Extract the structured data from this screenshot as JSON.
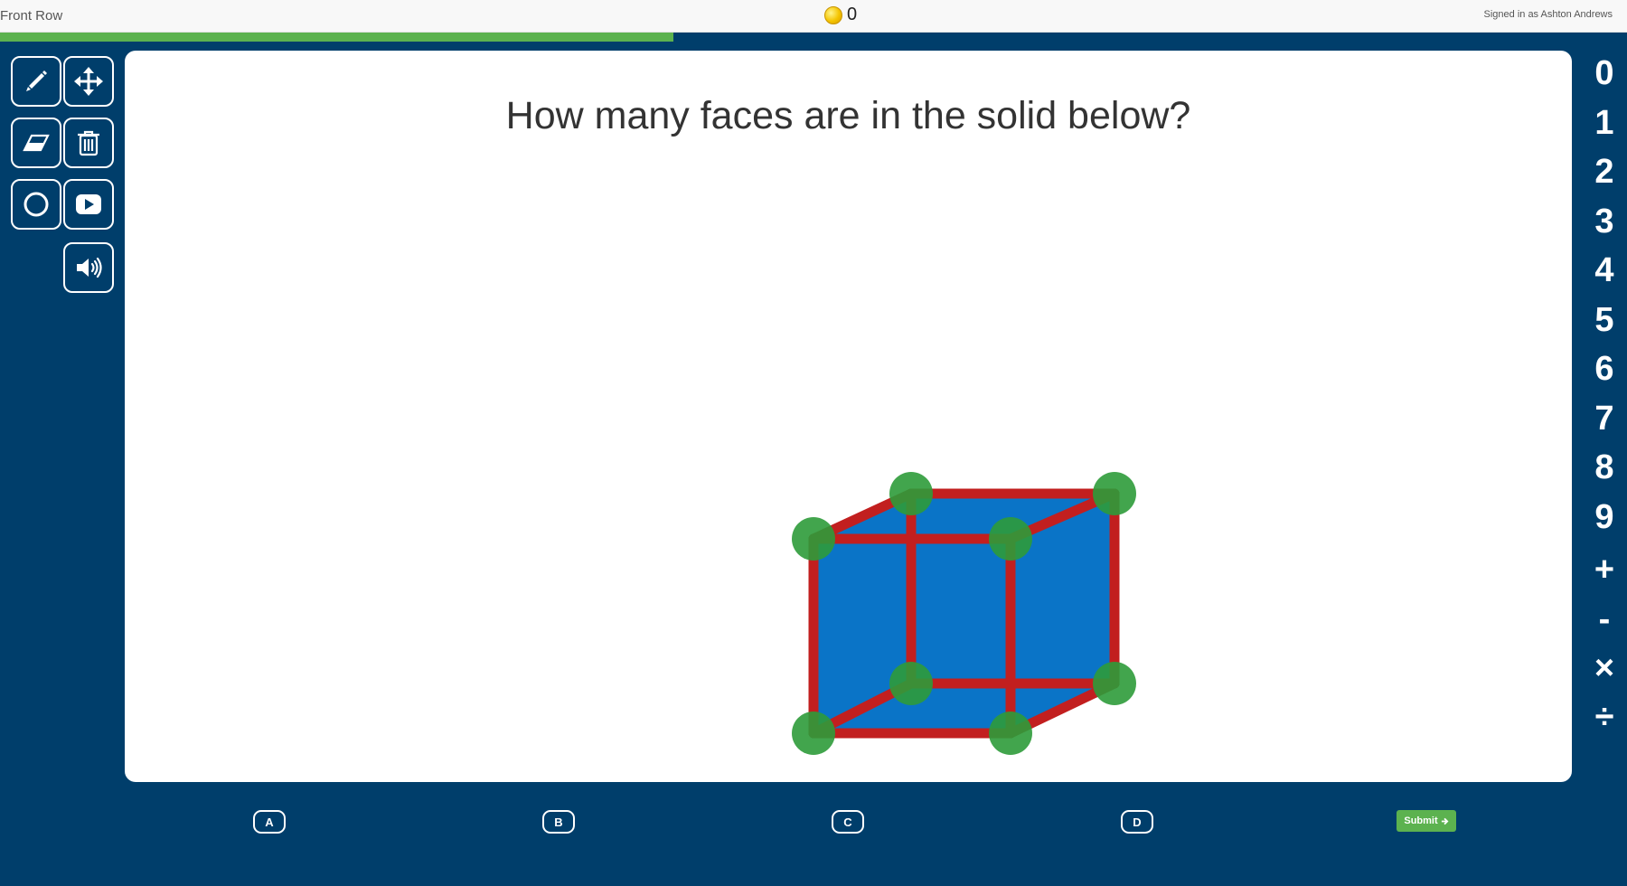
{
  "header": {
    "app_title": "Front Row",
    "coin_count": "0",
    "signed_in_text": "Signed in as Ashton Andrews"
  },
  "progress": {
    "fraction": 0.414
  },
  "tools": [
    {
      "name": "pencil-icon"
    },
    {
      "name": "move-icon"
    },
    {
      "name": "eraser-icon"
    },
    {
      "name": "trash-icon"
    },
    {
      "name": "circle-icon"
    },
    {
      "name": "video-play-icon"
    },
    {
      "name": "speaker-icon"
    }
  ],
  "question": {
    "text": "How many faces are in the solid below?"
  },
  "figure": {
    "solid": "cube",
    "face_color": "#0a74c7",
    "edge_color": "#c21f1f",
    "vertex_color": "#2e9b3a"
  },
  "numpad": [
    "0",
    "1",
    "2",
    "3",
    "4",
    "5",
    "6",
    "7",
    "8",
    "9",
    "+",
    "-",
    "×",
    "÷"
  ],
  "choices": [
    "A",
    "B",
    "C",
    "D"
  ],
  "submit": {
    "label": "Submit",
    "icon": "arrow-right-icon"
  },
  "colors": {
    "background": "#003e6b",
    "progress": "#5cb24f",
    "submit": "#5cb24f"
  }
}
